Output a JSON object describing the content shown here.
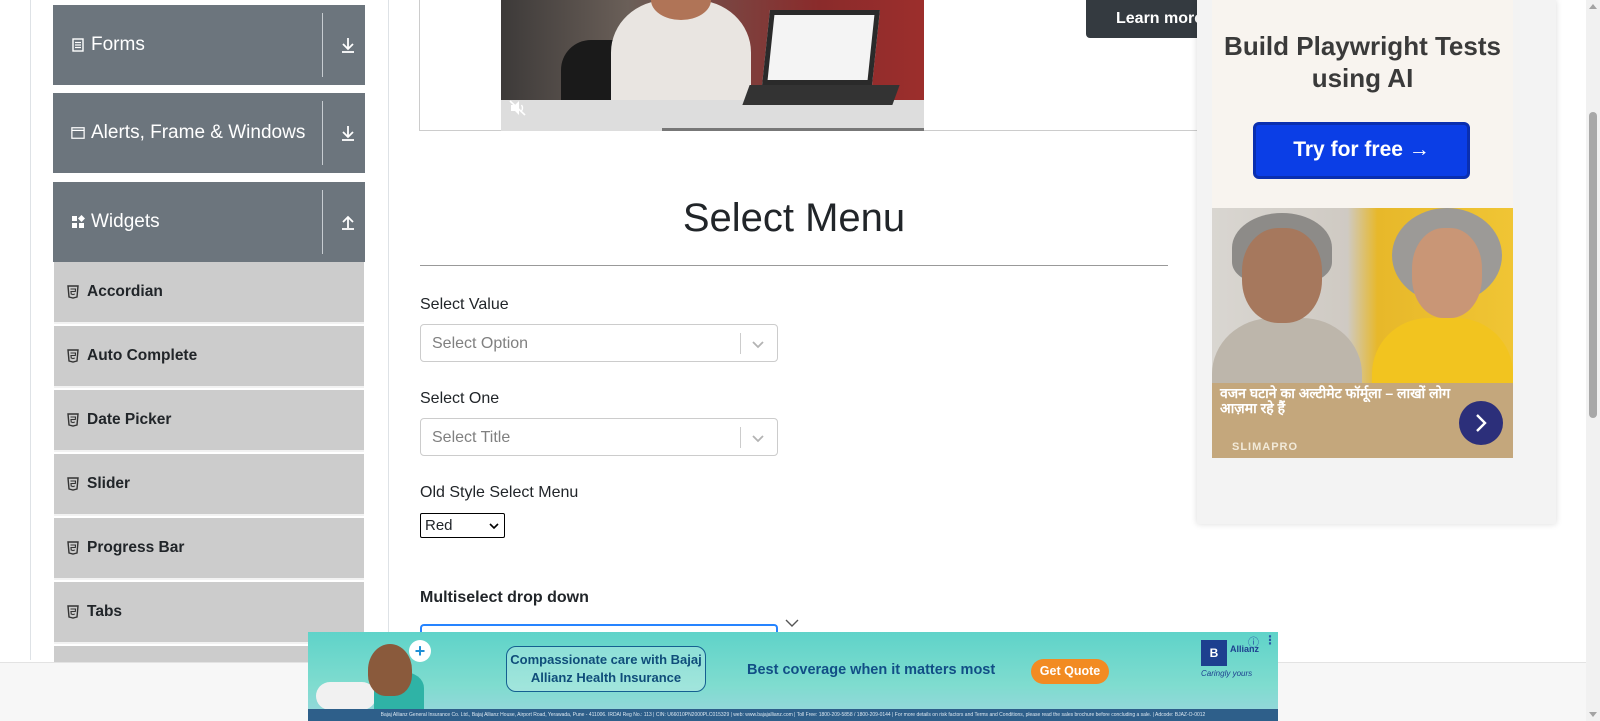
{
  "sidebar": {
    "groups": [
      {
        "label": "Forms",
        "icon": "form-icon",
        "arrow": "expand-arrow-icon"
      },
      {
        "label": "Alerts, Frame & Windows",
        "icon": "window-icon",
        "arrow": "expand-arrow-icon"
      },
      {
        "label": "Widgets",
        "icon": "widgets-icon",
        "arrow": "collapse-arrow-icon"
      }
    ],
    "items": [
      {
        "label": "Accordian",
        "icon": "html5-icon"
      },
      {
        "label": "Auto Complete",
        "icon": "html5-icon"
      },
      {
        "label": "Date Picker",
        "icon": "html5-icon"
      },
      {
        "label": "Slider",
        "icon": "html5-icon"
      },
      {
        "label": "Progress Bar",
        "icon": "html5-icon"
      },
      {
        "label": "Tabs",
        "icon": "html5-icon"
      }
    ]
  },
  "video": {
    "learn_more": "Learn more",
    "muted": true,
    "progress": 0.38
  },
  "main": {
    "title": "Select Menu",
    "select_value": {
      "label": "Select Value",
      "placeholder": "Select Option"
    },
    "select_one": {
      "label": "Select One",
      "placeholder": "Select Title"
    },
    "old_style": {
      "label": "Old Style Select Menu",
      "value": "Red"
    },
    "multiselect": {
      "label": "Multiselect drop down"
    }
  },
  "right_ad": {
    "title": "Build Playwright Tests using AI",
    "cta": "Try for free →",
    "caption": "वजन घटाने का अल्टीमेट फॉर्मूला – लाखों लोग आज़मा रहे हैं",
    "brand": "SLIMAPRO"
  },
  "bottom_ad": {
    "box_text": "Compassionate care with Bajaj Allianz Health Insurance",
    "tagline": "Best coverage when it matters most",
    "cta": "Get Quote",
    "logo": "B",
    "logo_text": "Allianz",
    "logo_sub": "Caringly yours",
    "fine_print": "Bajaj Allianz General Insurance Co. Ltd., Bajaj Allianz House, Airport Road, Yerawada, Pune - 411006. IRDAI Reg No.: 113 | CIN: U66010PN2000PLC015329 | web: www.bajajallianz.com | Toll Free: 1800-209-5858 / 1800-209-0144 | For more details on risk factors and Terms and Conditions, please read the sales brochure before concluding a sale. | Adcode: BJAZ-O-0012"
  },
  "colors": {
    "sidebar_header": "#6c757d",
    "sidebar_item": "#cccccc",
    "focus_blue": "#2684ff",
    "ad_cta_blue": "#0b3ee6",
    "quote_orange": "#f28b22"
  }
}
